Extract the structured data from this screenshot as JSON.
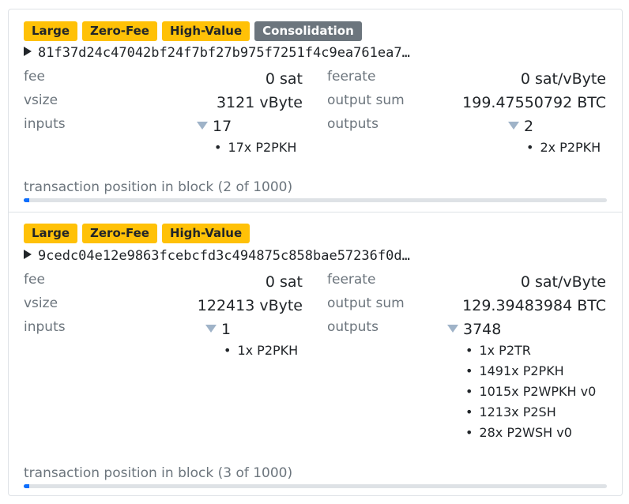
{
  "transactions": [
    {
      "badges": [
        {
          "label": "Large",
          "style": "warning"
        },
        {
          "label": "Zero-Fee",
          "style": "warning"
        },
        {
          "label": "High-Value",
          "style": "warning"
        },
        {
          "label": "Consolidation",
          "style": "secondary"
        }
      ],
      "txid": "81f37d24c47042bf24f7bf27b975f7251f4c9ea761ea7…",
      "fee_label": "fee",
      "fee": "0 sat",
      "feerate_label": "feerate",
      "feerate": "0 sat/vByte",
      "vsize_label": "vsize",
      "vsize": "3121 vByte",
      "output_sum_label": "output sum",
      "output_sum": "199.47550792 BTC",
      "inputs_label": "inputs",
      "inputs_count": "17",
      "input_types": [
        "17x P2PKH"
      ],
      "outputs_label": "outputs",
      "outputs_count": "2",
      "output_types": [
        "2x P2PKH"
      ],
      "position_label": "transaction position in block (2 of 1000)",
      "position_progress": 0.002
    },
    {
      "badges": [
        {
          "label": "Large",
          "style": "warning"
        },
        {
          "label": "Zero-Fee",
          "style": "warning"
        },
        {
          "label": "High-Value",
          "style": "warning"
        }
      ],
      "txid": "9cedc04e12e9863fcebcfd3c494875c858bae57236f0d…",
      "fee_label": "fee",
      "fee": "0 sat",
      "feerate_label": "feerate",
      "feerate": "0 sat/vByte",
      "vsize_label": "vsize",
      "vsize": "122413 vByte",
      "output_sum_label": "output sum",
      "output_sum": "129.39483984 BTC",
      "inputs_label": "inputs",
      "inputs_count": "1",
      "input_types": [
        "1x P2PKH"
      ],
      "outputs_label": "outputs",
      "outputs_count": "3748",
      "output_types": [
        "1x P2TR",
        "1491x P2PKH",
        "1015x P2WPKH v0",
        "1213x P2SH",
        "28x P2WSH v0"
      ],
      "position_label": "transaction position in block (3 of 1000)",
      "position_progress": 0.003
    }
  ],
  "colors": {
    "badge_warning": "#ffc107",
    "badge_secondary": "#6c757d",
    "progress": "#0d6efd"
  }
}
